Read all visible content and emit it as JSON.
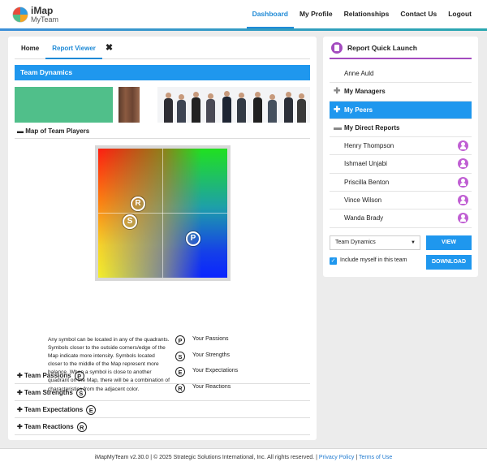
{
  "app": {
    "logo_title": "iMap",
    "logo_subtitle": "MyTeam"
  },
  "nav": {
    "items": [
      {
        "label": "Dashboard",
        "active": true
      },
      {
        "label": "My Profile"
      },
      {
        "label": "Relationships"
      },
      {
        "label": "Contact Us"
      },
      {
        "label": "Logout"
      }
    ]
  },
  "tabs": {
    "home": "Home",
    "report_viewer": "Report Viewer",
    "close_glyph": "✖"
  },
  "report": {
    "title": "Team Dynamics",
    "map_section_label": "Map of Team Players",
    "map_symbols": [
      "R",
      "S",
      "P"
    ],
    "legend_text": "Any symbol can be located in any of the quadrants. Symbols closer to the outside corners/edge of the Map indicate more intensity. Symbols located closer to the middle of the Map represent more balance. When a symbol is close to another quadrant on the Map, there will be a combination of characteristics from the adjacent color.",
    "legend": [
      {
        "symbol": "P",
        "label": "Your Passions"
      },
      {
        "symbol": "S",
        "label": "Your Strengths"
      },
      {
        "symbol": "E",
        "label": "Your Expectations"
      },
      {
        "symbol": "R",
        "label": "Your Reactions"
      }
    ],
    "accordions": [
      {
        "label": "Team Passions",
        "symbol": "P"
      },
      {
        "label": "Team Strengths",
        "symbol": "S"
      },
      {
        "label": "Team Expectations",
        "symbol": "E"
      },
      {
        "label": "Team Reactions",
        "symbol": "R"
      }
    ]
  },
  "quick_launch": {
    "title": "Report Quick Launch",
    "self_name": "Anne Auld",
    "groups": {
      "managers": "My Managers",
      "peers": "My Peers",
      "direct_reports": "My Direct Reports"
    },
    "direct_reports": [
      "Henry Thompson",
      "Ishmael Unjabi",
      "Priscilla Benton",
      "Vince Wilson",
      "Wanda Brady"
    ],
    "report_select": "Team Dynamics",
    "view_label": "VIEW",
    "download_label": "DOWNLOAD",
    "include_myself_label": "Include myself in this team",
    "include_myself_checked": true,
    "accent_color": "#a34bbf",
    "active_color": "#1f97ee"
  },
  "footer": {
    "copyright": "iMapMyTeam v2.30.0 | © 2025 Strategic Solutions International, Inc. All rights reserved. |",
    "privacy": "Privacy Policy",
    "separator": "|",
    "terms": "Terms of Use"
  }
}
